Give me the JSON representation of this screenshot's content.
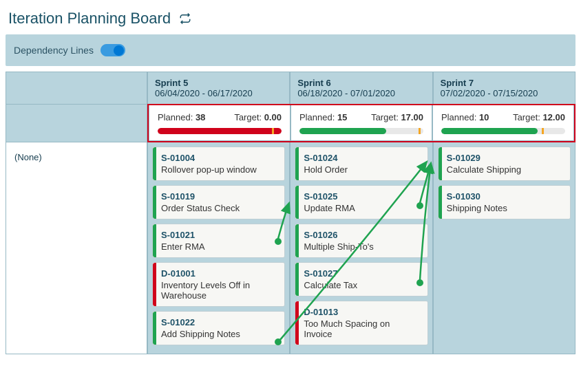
{
  "page": {
    "title": "Iteration Planning Board",
    "dependency_label": "Dependency Lines",
    "row_label": "(None)"
  },
  "sprints": [
    {
      "name": "Sprint 5",
      "dates": "06/04/2020 - 06/17/2020",
      "planned_label": "Planned:",
      "planned": "38",
      "target_label": "Target:",
      "target": "0.00",
      "bar_color": "#d0021b",
      "bar_pct": 100,
      "marker_pct": 92
    },
    {
      "name": "Sprint 6",
      "dates": "06/18/2020 - 07/01/2020",
      "planned_label": "Planned:",
      "planned": "15",
      "target_label": "Target:",
      "target": "17.00",
      "bar_color": "#1fa350",
      "bar_pct": 70,
      "marker_pct": 96
    },
    {
      "name": "Sprint 7",
      "dates": "07/02/2020 - 07/15/2020",
      "planned_label": "Planned:",
      "planned": "10",
      "target_label": "Target:",
      "target": "12.00",
      "bar_color": "#1fa350",
      "bar_pct": 78,
      "marker_pct": 81
    }
  ],
  "cards": {
    "sprint5": [
      {
        "id": "S-01004",
        "title": "Rollover pop-up window",
        "type": "story"
      },
      {
        "id": "S-01019",
        "title": "Order Status Check",
        "type": "story"
      },
      {
        "id": "S-01021",
        "title": "Enter RMA",
        "type": "story"
      },
      {
        "id": "D-01001",
        "title": "Inventory Levels Off in Warehouse",
        "type": "defect"
      },
      {
        "id": "S-01022",
        "title": "Add Shipping Notes",
        "type": "story"
      }
    ],
    "sprint6": [
      {
        "id": "S-01024",
        "title": "Hold Order",
        "type": "story"
      },
      {
        "id": "S-01025",
        "title": "Update RMA",
        "type": "story"
      },
      {
        "id": "S-01026",
        "title": "Multiple Ship-To's",
        "type": "story"
      },
      {
        "id": "S-01027",
        "title": "Calculate Tax",
        "type": "story"
      },
      {
        "id": "D-01013",
        "title": "Too Much Spacing on Invoice",
        "type": "defect"
      }
    ],
    "sprint7": [
      {
        "id": "S-01029",
        "title": "Calculate Shipping",
        "type": "story"
      },
      {
        "id": "S-01030",
        "title": "Shipping Notes",
        "type": "story"
      }
    ]
  }
}
